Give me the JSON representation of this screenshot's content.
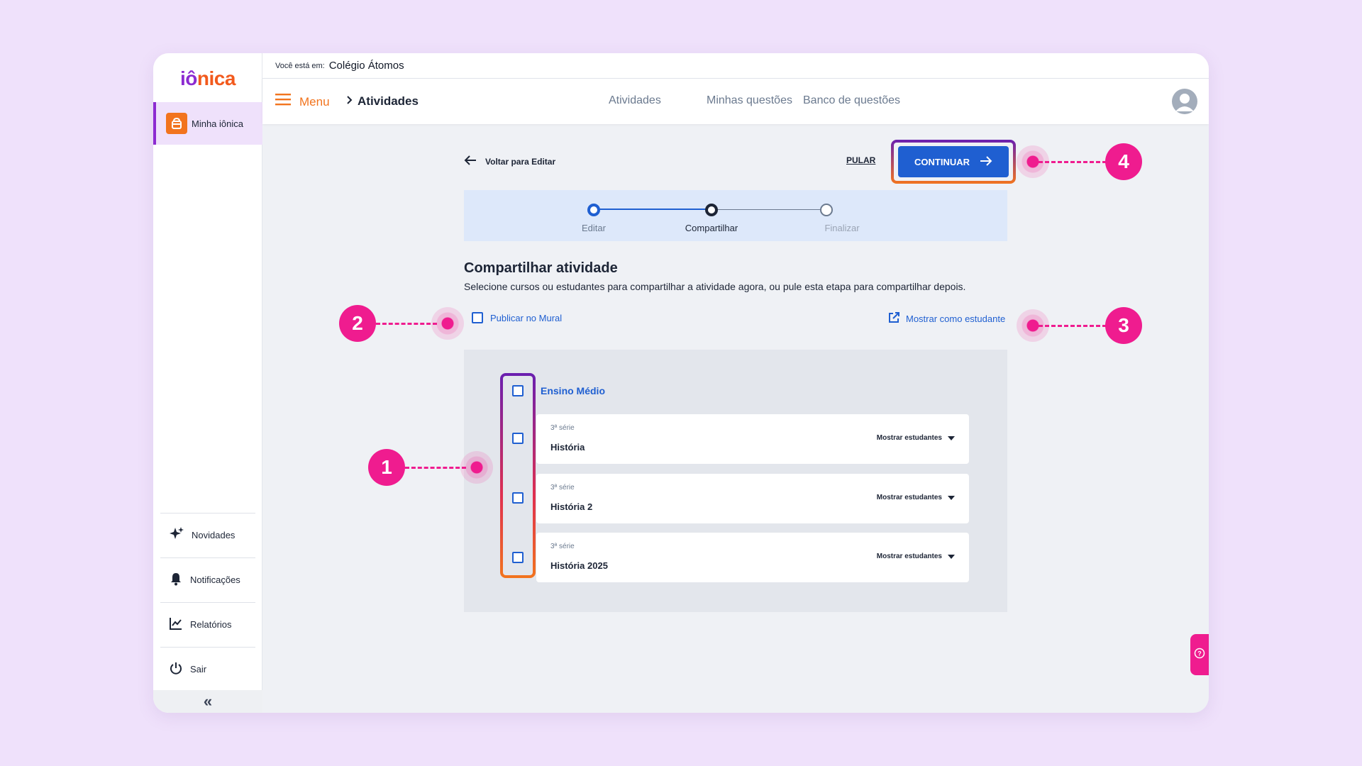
{
  "colors": {
    "background": "#efe1fb",
    "primary": "#1f5fd1",
    "orange": "#f2741e",
    "purple": "#8c2bd1",
    "callout": "#ef1c8f"
  },
  "sidebar": {
    "logo_a": "iô",
    "logo_b": "nica",
    "active_item": {
      "label": "Minha iônica",
      "icon": "backpack-icon"
    },
    "items": [
      {
        "label": "Novidades",
        "icon": "sparkles-icon"
      },
      {
        "label": "Notificações",
        "icon": "bell-icon"
      },
      {
        "label": "Relatórios",
        "icon": "chart-line-icon"
      },
      {
        "label": "Sair",
        "icon": "power-icon"
      }
    ],
    "collapse_label": "«"
  },
  "header": {
    "location_prefix": "Você está em:",
    "school": "Colégio Átomos",
    "menu_label": "Menu",
    "breadcrumb": "Atividades",
    "tabs": [
      "Atividades",
      "Minhas questões",
      "Banco de questões"
    ]
  },
  "toolbar": {
    "back_label": "Voltar para Editar",
    "skip_label": "PULAR",
    "continue_label": "CONTINUAR"
  },
  "stepper": {
    "steps": [
      {
        "label": "Editar",
        "state": "done"
      },
      {
        "label": "Compartilhar",
        "state": "current"
      },
      {
        "label": "Finalizar",
        "state": "pending"
      }
    ]
  },
  "main": {
    "title": "Compartilhar atividade",
    "subtitle": "Selecione cursos ou estudantes para compartilhar a atividade agora, ou pule esta etapa para compartilhar depois.",
    "publish_label": "Publicar no Mural",
    "student_view_label": "Mostrar como estudante",
    "group_label": "Ensino Médio",
    "courses": [
      {
        "serie": "3ª série",
        "name": "História",
        "action": "Mostrar estudantes"
      },
      {
        "serie": "3ª série",
        "name": "História 2",
        "action": "Mostrar estudantes"
      },
      {
        "serie": "3ª série",
        "name": "História 2025",
        "action": "Mostrar estudantes"
      }
    ]
  },
  "callouts": [
    "1",
    "2",
    "3",
    "4"
  ]
}
